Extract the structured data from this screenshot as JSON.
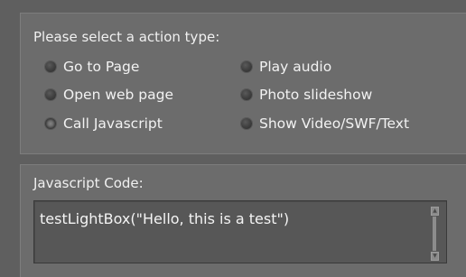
{
  "action_panel": {
    "title": "Please select a action type:",
    "options": [
      {
        "label": "Go to Page",
        "selected": false
      },
      {
        "label": "Play audio",
        "selected": false
      },
      {
        "label": "Open web page",
        "selected": false
      },
      {
        "label": "Photo slideshow",
        "selected": false
      },
      {
        "label": "Call Javascript",
        "selected": true
      },
      {
        "label": "Show Video/SWF/Text",
        "selected": false
      }
    ]
  },
  "code_panel": {
    "title": "Javascript Code:",
    "value": "testLightBox(\"Hello, this is a test\")"
  }
}
